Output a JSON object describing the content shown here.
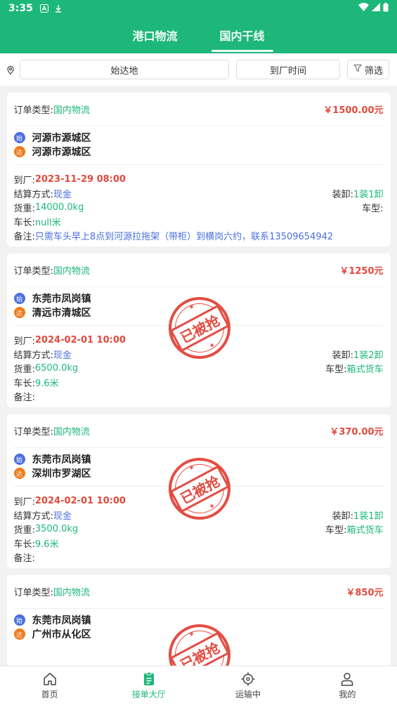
{
  "status_bar": {
    "time": "3:35"
  },
  "header": {
    "tabs": [
      {
        "label": "港口物流"
      },
      {
        "label": "国内干线"
      }
    ]
  },
  "filters": {
    "origin_label": "始达地",
    "time_label": "到厂时间",
    "filter_label": "筛选"
  },
  "labels": {
    "order_type": "订单类型:",
    "arrive": "到厂:",
    "settle": "结算方式:",
    "load": "装卸:",
    "weight": "货重:",
    "truck_type": "车型:",
    "length": "车长:",
    "remark": "备注:",
    "start_badge": "始",
    "end_badge": "达",
    "stamp_text": "已被抢"
  },
  "orders": [
    {
      "type": "国内物流",
      "price": "￥1500.00元",
      "from": "河源市源城区",
      "to": "河源市源城区",
      "arrive": "2023-11-29 08:00",
      "settle": "现金",
      "load": "1装1卸",
      "weight": "14000.0kg",
      "truck_type": "",
      "length": "null米",
      "remark": "只需车头早上8点到河源拉拖架（带柜）到横岗六约，联系13509654942"
    },
    {
      "type": "国内物流",
      "price": "￥1250元",
      "from": "东莞市凤岗镇",
      "to": "清远市清城区",
      "arrive": "2024-02-01 10:00",
      "settle": "现金",
      "load": "1装2卸",
      "weight": "6500.0kg",
      "truck_type": "箱式货车",
      "length": "9.6米",
      "remark": ""
    },
    {
      "type": "国内物流",
      "price": "￥370.00元",
      "from": "东莞市凤岗镇",
      "to": "深圳市罗湖区",
      "arrive": "2024-02-01 10:00",
      "settle": "现金",
      "load": "1装1卸",
      "weight": "3500.0kg",
      "truck_type": "箱式货车",
      "length": "9.6米",
      "remark": ""
    },
    {
      "type": "国内物流",
      "price": "￥850元",
      "from": "东莞市凤岗镇",
      "to": "广州市从化区"
    }
  ],
  "bottom_nav": [
    {
      "label": "首页"
    },
    {
      "label": "接单大厅"
    },
    {
      "label": "运输中"
    },
    {
      "label": "我的"
    }
  ],
  "colors": {
    "primary": "#1db77a",
    "price_red": "#e04b3c",
    "link_blue": "#4a6fe0",
    "stamp_red": "#e03a2f"
  }
}
